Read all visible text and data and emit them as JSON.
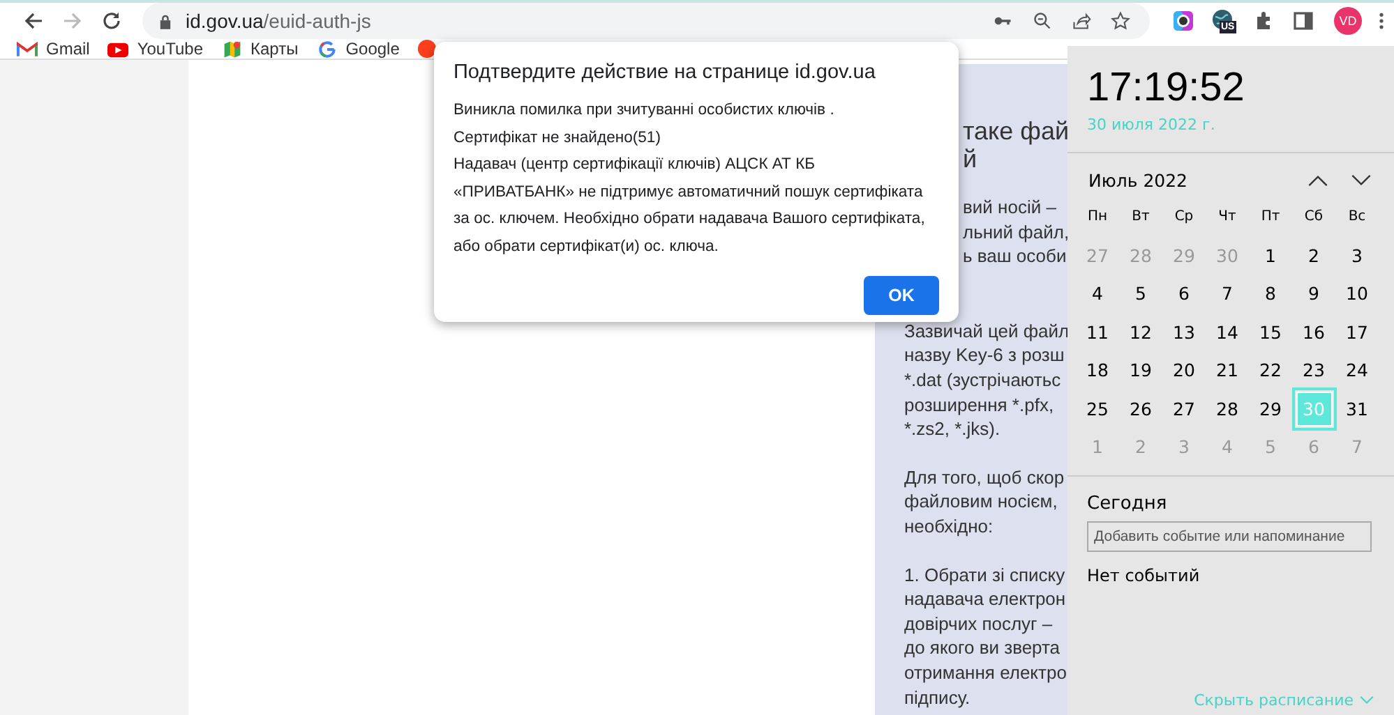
{
  "browser": {
    "url_host": "id.gov.ua",
    "url_path": "/euid-auth-js",
    "extension_badge": "US",
    "avatar": "VD"
  },
  "bookmarks": [
    {
      "label": "Gmail",
      "kind": "gmail"
    },
    {
      "label": "YouTube",
      "kind": "youtube"
    },
    {
      "label": "Карты",
      "kind": "maps"
    },
    {
      "label": "Google",
      "kind": "google"
    },
    {
      "kind": "yandex"
    }
  ],
  "page": {
    "heading_lines": [
      "таке фай",
      "й"
    ],
    "hidden_lines": [
      "вий носій –",
      "льний файл,",
      "ь ваш особи"
    ],
    "paragraphs": [
      [
        "Зазвичай цей файл",
        "назву Key-6 з розш",
        "*.dat (зустрічаютьс",
        "розширення *.pfx,",
        "*.zs2, *.jks)."
      ],
      [
        "Для того, щоб скор",
        "файловим носієм,",
        "необхідно:"
      ],
      [
        "1. Обрати зі списку",
        "надавача електрон",
        "довірчих послуг –",
        "до якого ви зверта",
        "отримання електро",
        "підпису."
      ]
    ]
  },
  "dialog": {
    "title": "Подтвердите действие на странице id.gov.ua",
    "message_lines": [
      "Виникла помилка при зчитуванні особистих ключів .",
      "Сертифікат не знайдено(51)",
      "Надавач (центр сертифікації ключів) АЦСК АТ КБ «ПРИВАТБАНК» не підтримує автоматичний пошук сертифіката за ос. ключем. Необхідно обрати надавача Вашого сертифіката, або обрати сертифікат(и) ос. ключа."
    ],
    "ok_button": "OK"
  },
  "clock": {
    "time": "17:19:52",
    "date": "30 июля 2022 г.",
    "month": "Июль 2022",
    "weekdays": [
      "Пн",
      "Вт",
      "Ср",
      "Чт",
      "Пт",
      "Сб",
      "Вс"
    ],
    "weeks": [
      [
        {
          "day": "27",
          "other_month": true,
          "selected": false
        },
        {
          "day": "28",
          "other_month": true,
          "selected": false
        },
        {
          "day": "29",
          "other_month": true,
          "selected": false
        },
        {
          "day": "30",
          "other_month": true,
          "selected": false
        },
        {
          "day": "1",
          "other_month": false,
          "selected": false
        },
        {
          "day": "2",
          "other_month": false,
          "selected": false
        },
        {
          "day": "3",
          "other_month": false,
          "selected": false
        }
      ],
      [
        {
          "day": "4",
          "other_month": false,
          "selected": false
        },
        {
          "day": "5",
          "other_month": false,
          "selected": false
        },
        {
          "day": "6",
          "other_month": false,
          "selected": false
        },
        {
          "day": "7",
          "other_month": false,
          "selected": false
        },
        {
          "day": "8",
          "other_month": false,
          "selected": false
        },
        {
          "day": "9",
          "other_month": false,
          "selected": false
        },
        {
          "day": "10",
          "other_month": false,
          "selected": false
        }
      ],
      [
        {
          "day": "11",
          "other_month": false,
          "selected": false
        },
        {
          "day": "12",
          "other_month": false,
          "selected": false
        },
        {
          "day": "13",
          "other_month": false,
          "selected": false
        },
        {
          "day": "14",
          "other_month": false,
          "selected": false
        },
        {
          "day": "15",
          "other_month": false,
          "selected": false
        },
        {
          "day": "16",
          "other_month": false,
          "selected": false
        },
        {
          "day": "17",
          "other_month": false,
          "selected": false
        }
      ],
      [
        {
          "day": "18",
          "other_month": false,
          "selected": false
        },
        {
          "day": "19",
          "other_month": false,
          "selected": false
        },
        {
          "day": "20",
          "other_month": false,
          "selected": false
        },
        {
          "day": "21",
          "other_month": false,
          "selected": false
        },
        {
          "day": "22",
          "other_month": false,
          "selected": false
        },
        {
          "day": "23",
          "other_month": false,
          "selected": false
        },
        {
          "day": "24",
          "other_month": false,
          "selected": false
        }
      ],
      [
        {
          "day": "25",
          "other_month": false,
          "selected": false
        },
        {
          "day": "26",
          "other_month": false,
          "selected": false
        },
        {
          "day": "27",
          "other_month": false,
          "selected": false
        },
        {
          "day": "28",
          "other_month": false,
          "selected": false
        },
        {
          "day": "29",
          "other_month": false,
          "selected": false
        },
        {
          "day": "30",
          "other_month": false,
          "selected": true
        },
        {
          "day": "31",
          "other_month": false,
          "selected": false
        }
      ],
      [
        {
          "day": "1",
          "other_month": true,
          "selected": false
        },
        {
          "day": "2",
          "other_month": true,
          "selected": false
        },
        {
          "day": "3",
          "other_month": true,
          "selected": false
        },
        {
          "day": "4",
          "other_month": true,
          "selected": false
        },
        {
          "day": "5",
          "other_month": true,
          "selected": false
        },
        {
          "day": "6",
          "other_month": true,
          "selected": false
        },
        {
          "day": "7",
          "other_month": true,
          "selected": false
        }
      ]
    ],
    "today_label": "Сегодня",
    "event_placeholder": "Добавить событие или напоминание",
    "no_events": "Нет событий",
    "hide_link": "Скрыть расписание"
  }
}
